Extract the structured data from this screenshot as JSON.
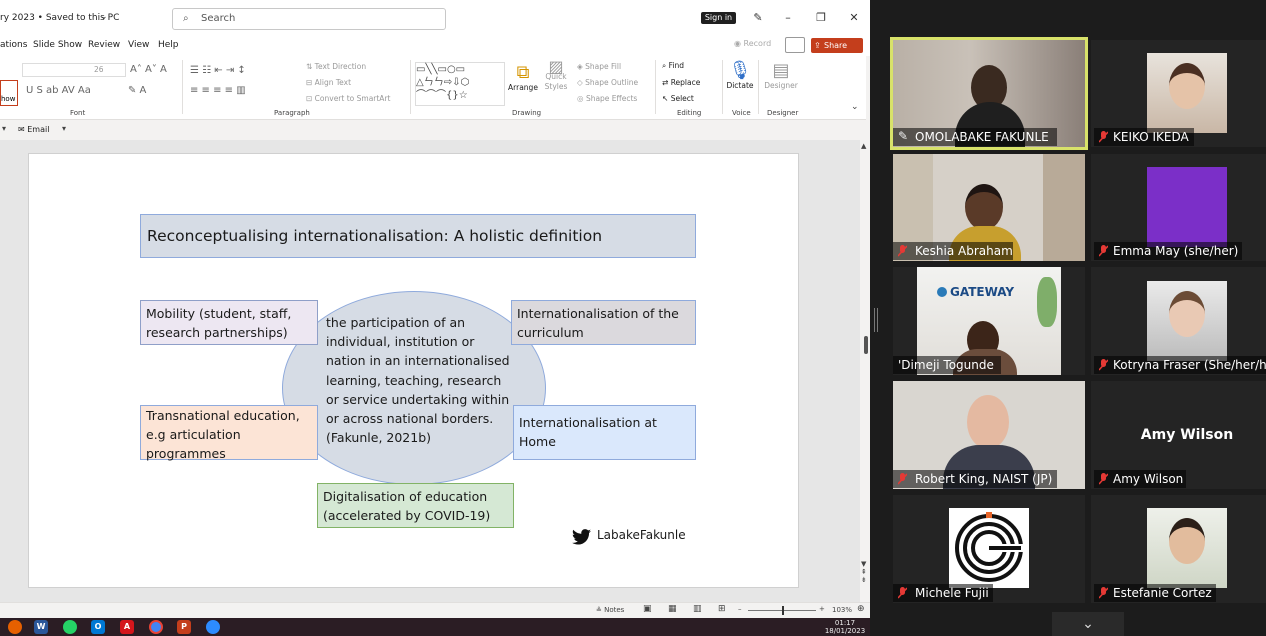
{
  "window": {
    "title": "ry 2023 • Saved to this PC",
    "search_placeholder": "Search",
    "signin": "Sign in"
  },
  "menu": {
    "items": [
      "ations",
      "Slide Show",
      "Review",
      "View",
      "Help"
    ],
    "record": "Record",
    "share": "Share"
  },
  "ribbon": {
    "font_size": "26",
    "text_direction": "Text Direction",
    "align_text": "Align Text",
    "convert_smartart": "Convert to SmartArt",
    "arrange": "Arrange",
    "quick_styles": "Quick Styles",
    "shape_fill": "Shape Fill",
    "shape_outline": "Shape Outline",
    "shape_effects": "Shape Effects",
    "find": "Find",
    "replace": "Replace",
    "select": "Select",
    "dictate": "Dictate",
    "designer": "Designer",
    "show": "how",
    "groups": {
      "font": "Font",
      "paragraph": "Paragraph",
      "drawing": "Drawing",
      "editing": "Editing",
      "voice": "Voice",
      "designer": "Designer"
    },
    "email": "Email"
  },
  "slide": {
    "title": "Reconceptualising internationalisation: A holistic definition",
    "center": "the participation of an individual, institution or nation in an internationalised learning, teaching, research or service undertaking within or across national borders. (Fakunle, 2021b)",
    "mobility": "Mobility (student, staff, research partnerships)",
    "curriculum": "Internationalisation of the curriculum",
    "transnational": "Transnational education, e.g articulation programmes",
    "home": "Internationalisation at Home",
    "digital": "Digitalisation of education (accelerated by COVID-19)",
    "twitter": "LabakeFakunle"
  },
  "status": {
    "notes": "Notes",
    "zoom": "103%"
  },
  "clock": {
    "time": "01:17",
    "date": "18/01/2023"
  },
  "participants": [
    {
      "name": "OMOLABAKE FAKUNLE"
    },
    {
      "name": "KEIKO IKEDA"
    },
    {
      "name": "Keshia Abraham"
    },
    {
      "name": "Emma May (she/her)"
    },
    {
      "name": "'Dimeji Togunde"
    },
    {
      "name": "Kotryna Fraser (She/her/he"
    },
    {
      "name": "Robert King, NAIST (JP)"
    },
    {
      "name": "Amy Wilson"
    },
    {
      "name": "Michele Fujii"
    },
    {
      "name": "Estefanie Cortez"
    }
  ],
  "amy_label": "Amy Wilson",
  "gateway_logo": "GATEWAY",
  "colors": {
    "active_speaker": "#d8e26a",
    "share": "#c43e1c",
    "emma_avatar": "#7b2fc8"
  }
}
